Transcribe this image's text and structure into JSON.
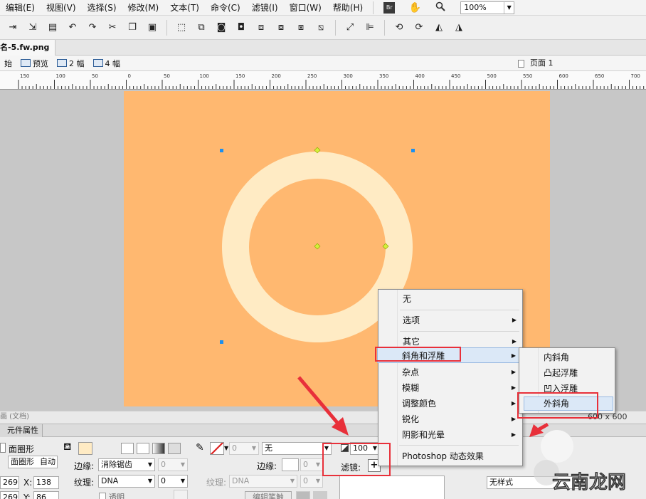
{
  "menubar": {
    "items": [
      "编辑(E)",
      "视图(V)",
      "选择(S)",
      "修改(M)",
      "文本(T)",
      "命令(C)",
      "滤镜(I)",
      "窗口(W)",
      "帮助(H)"
    ],
    "bridge_icon_label": "Br",
    "zoom": "100%"
  },
  "doc": {
    "tab_title": "名-5.fw.png"
  },
  "viewbar": {
    "original": "始",
    "preview": "预览",
    "two_up": "2 幅",
    "four_up": "4 幅",
    "page": "页面 1"
  },
  "ruler": {
    "labels": [
      "150",
      "100",
      "50",
      "0",
      "50",
      "100",
      "150",
      "200",
      "250",
      "300",
      "350",
      "400",
      "450",
      "500",
      "550",
      "600",
      "650",
      "700"
    ]
  },
  "status": {
    "left_text": "画 (文档)",
    "doc_size": "600 x 600"
  },
  "props": {
    "tab_label": "元件属性",
    "shape_name_1": "面圈形",
    "shape_name_2": "面圈形",
    "auto_label": "自动",
    "edge_label": "边缘:",
    "edge_value": "消除锯齿",
    "edge_num": "0",
    "texture_label": "纹理:",
    "texture_value": "DNA",
    "texture_num": "0",
    "transparent_label": "透明",
    "stroke_edge_label": "边缘:",
    "stroke_edge_num": "0",
    "stroke_texture_label": "纹理:",
    "stroke_texture_value": "DNA",
    "stroke_texture_num": "0",
    "stroke_num": "0",
    "stroke_type": "无",
    "edit_stroke_btn": "编辑笔触",
    "opacity": "100",
    "filter_label": "滤镜:",
    "filter_add": "+",
    "style_value": "无样式",
    "w_value": "269",
    "x_label": "X:",
    "x_value": "138",
    "h_value": "269",
    "y_label": "Y:",
    "y_value": "86"
  },
  "context_menu": {
    "items": [
      "无",
      "选项",
      "其它",
      "斜角和浮雕",
      "杂点",
      "模糊",
      "调整颜色",
      "锐化",
      "阴影和光晕",
      "Photoshop 动态效果"
    ],
    "highlighted": "斜角和浮雕"
  },
  "submenu": {
    "items": [
      "内斜角",
      "凸起浮雕",
      "凹入浮雕",
      "外斜角"
    ],
    "highlighted": "外斜角"
  },
  "watermark": "云南龙网",
  "colors": {
    "artboard": "#ffb870",
    "ring": "#ffebc4",
    "annotation": "#e8303a",
    "handle": "#1a8ff0",
    "node": "#d4f03a"
  }
}
